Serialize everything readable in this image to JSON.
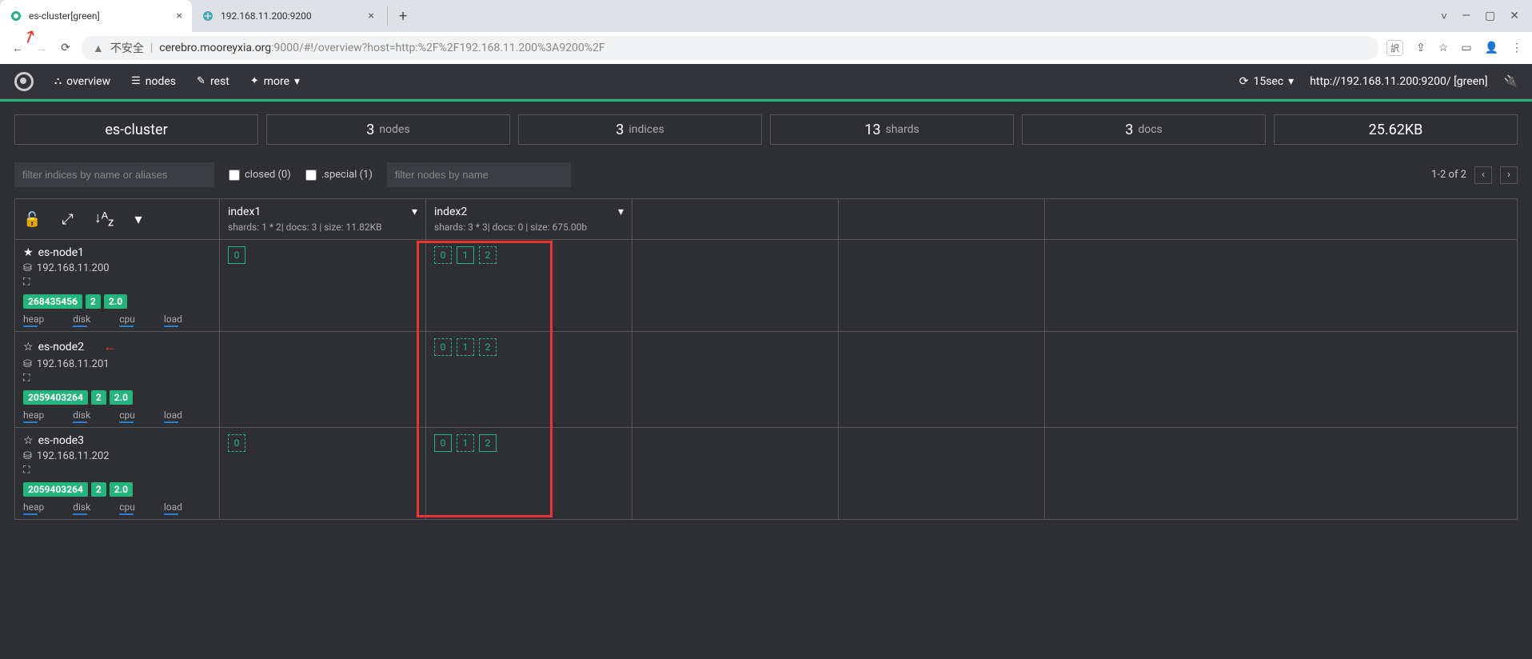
{
  "browser": {
    "tabs": [
      {
        "title": "es-cluster[green]",
        "active": true
      },
      {
        "title": "192.168.11.200:9200",
        "active": false
      }
    ],
    "url_insecure": "不安全",
    "url_host": "cerebro.mooreyxia.org",
    "url_path": ":9000/#!/overview?host=http:%2F%2F192.168.11.200%3A9200%2F"
  },
  "nav": {
    "overview": "overview",
    "nodes": "nodes",
    "rest": "rest",
    "more": "more",
    "refresh": "15sec",
    "host": "http://192.168.11.200:9200/ [green]"
  },
  "stats": {
    "cluster": "es-cluster",
    "nodes_n": "3",
    "nodes_l": "nodes",
    "indices_n": "3",
    "indices_l": "indices",
    "shards_n": "13",
    "shards_l": "shards",
    "docs_n": "3",
    "docs_l": "docs",
    "size": "25.62KB"
  },
  "filters": {
    "idx_placeholder": "filter indices by name or aliases",
    "node_placeholder": "filter nodes by name",
    "closed": "closed (0)",
    "special": ".special (1)",
    "pager": "1-2 of 2"
  },
  "indices": [
    {
      "name": "index1",
      "sub": "shards: 1 * 2| docs: 3 | size: 11.82KB"
    },
    {
      "name": "index2",
      "sub": "shards: 3 * 3| docs: 0 | size: 675.00b"
    }
  ],
  "nodes_list": [
    {
      "name": "es-node1",
      "ip": "192.168.11.200",
      "master": true,
      "badges": [
        "268435456",
        "2",
        "2.0"
      ],
      "shards": {
        "index1": [
          {
            "n": "0",
            "t": "solid"
          }
        ],
        "index2": [
          {
            "n": "0",
            "t": "dashed"
          },
          {
            "n": "1",
            "t": "solid"
          },
          {
            "n": "2",
            "t": "dashed"
          }
        ]
      }
    },
    {
      "name": "es-node2",
      "ip": "192.168.11.201",
      "master": false,
      "arrow": true,
      "badges": [
        "2059403264",
        "2",
        "2.0"
      ],
      "shards": {
        "index1": [],
        "index2": [
          {
            "n": "0",
            "t": "dashed"
          },
          {
            "n": "1",
            "t": "dashed"
          },
          {
            "n": "2",
            "t": "dashed"
          }
        ]
      }
    },
    {
      "name": "es-node3",
      "ip": "192.168.11.202",
      "master": false,
      "badges": [
        "2059403264",
        "2",
        "2.0"
      ],
      "shards": {
        "index1": [
          {
            "n": "0",
            "t": "dashed"
          }
        ],
        "index2": [
          {
            "n": "0",
            "t": "solid"
          },
          {
            "n": "1",
            "t": "dashed"
          },
          {
            "n": "2",
            "t": "solid"
          }
        ]
      }
    }
  ],
  "metric_labels": [
    "heap",
    "disk",
    "cpu",
    "load"
  ]
}
